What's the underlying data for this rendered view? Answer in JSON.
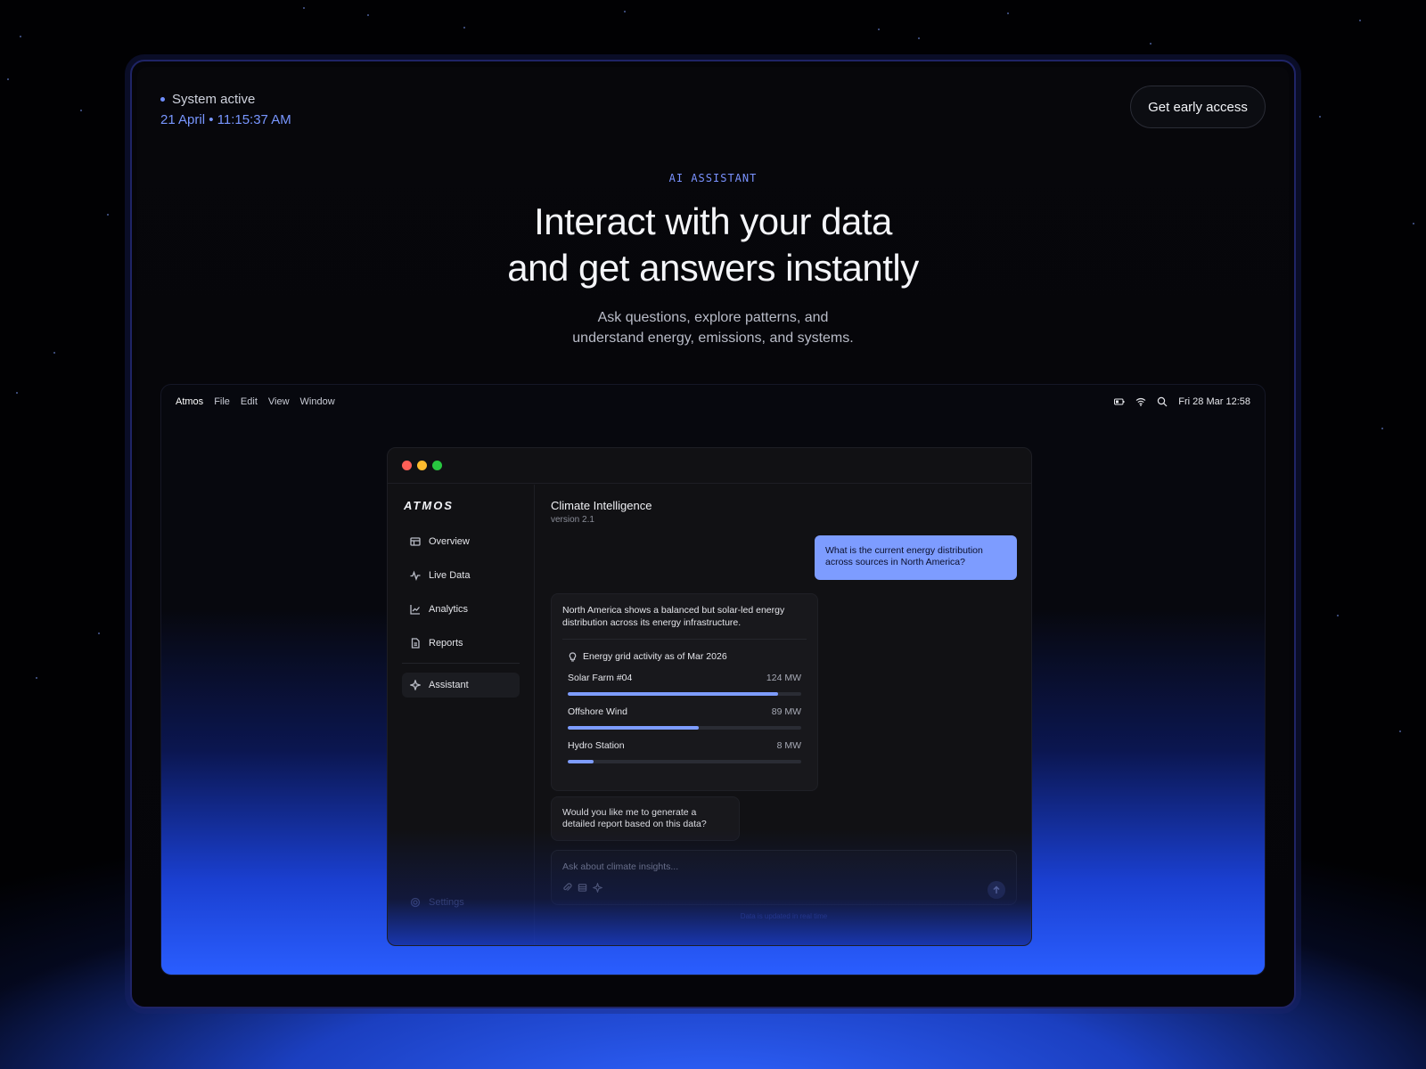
{
  "status": {
    "label": "System active",
    "datetime": "21 April • 11:15:37 AM"
  },
  "cta": {
    "label": "Get early access"
  },
  "hero": {
    "eyebrow": "AI ASSISTANT",
    "headline_line1": "Interact with your data",
    "headline_line2": "and get answers instantly",
    "sub_line1": "Ask questions, explore patterns, and",
    "sub_line2": "understand energy, emissions, and systems."
  },
  "menubar": {
    "app": "Atmos",
    "items": [
      "File",
      "Edit",
      "View",
      "Window"
    ],
    "clock": "Fri 28 Mar 12:58",
    "icons": [
      "battery-icon",
      "wifi-icon",
      "search-icon"
    ]
  },
  "app": {
    "logo": "ATMOS",
    "nav": [
      {
        "label": "Overview",
        "icon": "table-icon"
      },
      {
        "label": "Live Data",
        "icon": "pulse-icon"
      },
      {
        "label": "Analytics",
        "icon": "chart-line-icon"
      },
      {
        "label": "Reports",
        "icon": "document-icon"
      }
    ],
    "assistant_label": "Assistant",
    "settings_label": "Settings",
    "conversation": {
      "title": "Climate Intelligence",
      "version": "version 2.1",
      "user_message": "What is the current energy distribution across sources in North America?",
      "ai_intro": "North America shows a balanced but solar-led energy distribution across its energy infrastructure.",
      "grid_heading": "Energy grid activity as of Mar 2026",
      "sources": [
        {
          "name": "Solar Farm #04",
          "value": "124 MW",
          "fraction": 0.9
        },
        {
          "name": "Offshore Wind",
          "value": "89 MW",
          "fraction": 0.56
        },
        {
          "name": "Hydro Station",
          "value": "8 MW",
          "fraction": 0.11
        }
      ],
      "ai_followup": "Would you like me to generate a detailed report based on this data?",
      "input_placeholder": "Ask about climate insights...",
      "footer_note": "Data is updated in real time"
    }
  },
  "colors": {
    "accent": "#7d9cff",
    "brand_blue": "#2f63ff",
    "user_bubble": "#7d9cff"
  }
}
